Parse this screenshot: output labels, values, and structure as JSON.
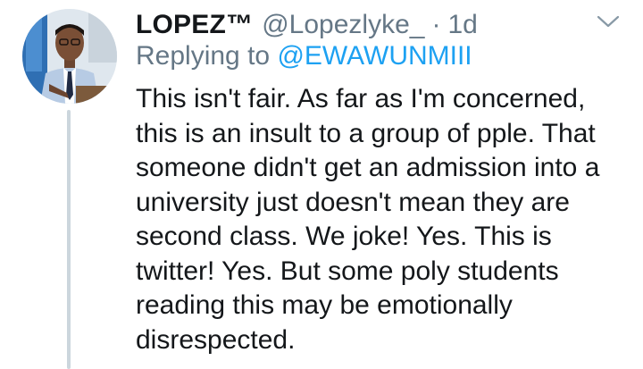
{
  "tweet": {
    "display_name": "LOPEZ™",
    "handle": "@Lopezlyke_",
    "separator": "·",
    "time": "1d",
    "replying_prefix": "Replying to ",
    "replying_to": "@EWAWUNMIII",
    "body_lines": [
      "This isn't fair. As far as I'm concerned,",
      "this is an insult to a group of pple. That",
      "someone didn't get an admission into a",
      "university just doesn't mean they are",
      "second class. We joke! Yes. This is",
      "twitter! Yes. But some poly students",
      "reading this may be emotionally",
      "disrespected."
    ]
  },
  "icons": {
    "menu": "chevron-down-icon",
    "avatar": "avatar"
  },
  "colors": {
    "primary_text": "#14171a",
    "secondary_text": "#657786",
    "link": "#1da1f2",
    "thread_line": "#ccd6dd"
  }
}
